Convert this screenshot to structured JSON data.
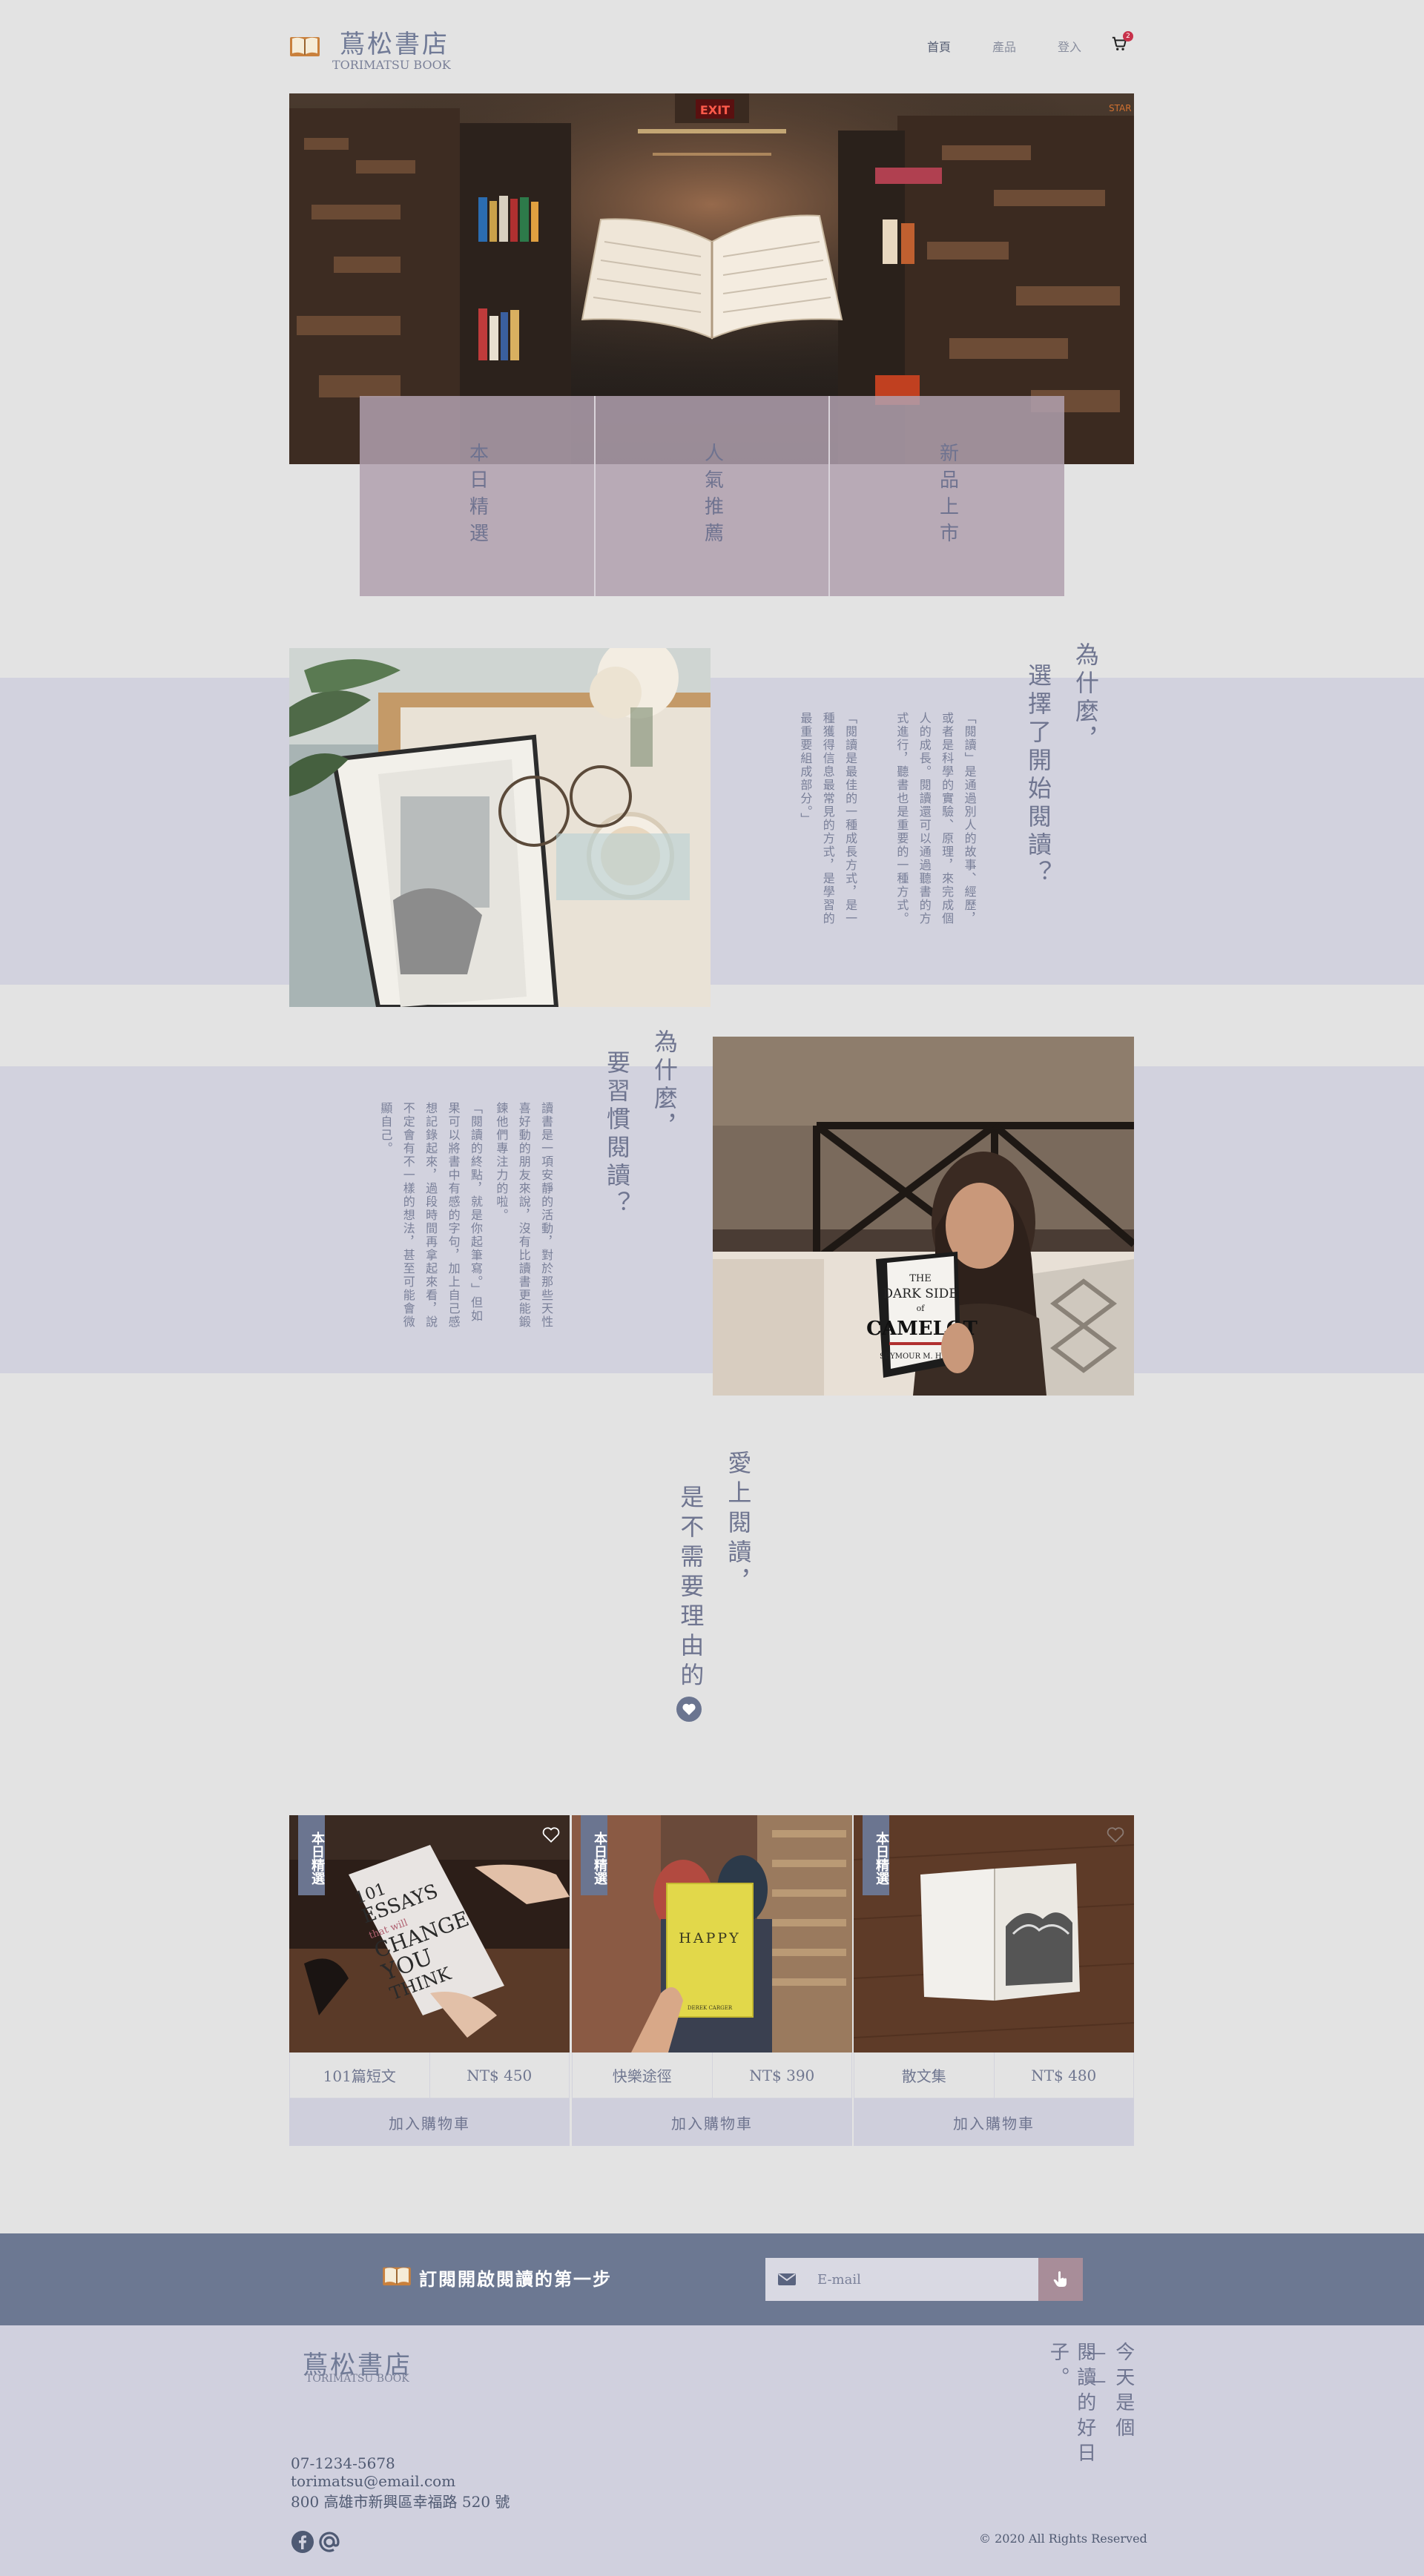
{
  "brand": {
    "name": "蔦松書店",
    "subtitle": "TORIMATSU BOOK"
  },
  "nav": {
    "home": "首頁",
    "products": "產品",
    "login": "登入",
    "cart_count": "2"
  },
  "categories": [
    {
      "label": "本日精選"
    },
    {
      "label": "人氣推薦"
    },
    {
      "label": "新品上市"
    }
  ],
  "section1": {
    "heading_line1": "為什麼，",
    "heading_line2": "選擇了開始閱讀？",
    "para1": "「閱讀」是通過別人的故事、經歷，或者是科學的實驗、原理，來完成個人的成長。閱讀還可以通過聽書的方式進行，聽書也是重要的一種方式。",
    "para2": "「閱讀是最佳的一種成長方式，是一種獲得信息最常見的方式，是學習的最重要組成部分。」"
  },
  "section2": {
    "heading_line1": "為什麼，",
    "heading_line2": "要習慣閱讀？",
    "para1": "讀書是一項安靜的活動，對於那些天性喜好動的朋友來說，沒有比讀書更能鍛鍊他們專注力的啦。",
    "para2": "「閱讀的終點，就是你起筆寫。」但如果可以將書中有感的字句，加上自己感想記錄起來，過段時間再拿起來看，說不定會有不一樣的想法，甚至可能會微顯自己。"
  },
  "love": {
    "line1": "愛上閱讀，",
    "line2": "是不需要理由的"
  },
  "products": [
    {
      "ribbon": "本日精選",
      "name": "101篇短文",
      "price": "NT$ 450",
      "button": "加入購物車"
    },
    {
      "ribbon": "本日精選",
      "name": "快樂途徑",
      "price": "NT$ 390",
      "button": "加入購物車"
    },
    {
      "ribbon": "本日精選",
      "name": "散文集",
      "price": "NT$ 480",
      "button": "加入購物車"
    }
  ],
  "subscribe": {
    "title": "訂閱開啟閱讀的第一步",
    "placeholder": "E-mail"
  },
  "footer": {
    "name": "蔦松書店",
    "subtitle": "TORIMATSU BOOK",
    "phone": "07-1234-5678",
    "email": "torimatsu@email.com",
    "address": "800 高雄市新興區幸福路 520 號",
    "slogan_line1": "今天是個——",
    "slogan_line2": "閱讀的好日子。",
    "copyright": "© 2020 All Rights Reserved"
  },
  "colors": {
    "accent": "#6b7590",
    "band": "#d2d2de",
    "category_overlay": "#b0a0ae",
    "badge": "#c8324b"
  },
  "icons": [
    "book-logo-icon",
    "cart-icon",
    "heart-icon",
    "heart-outline-icon",
    "mail-icon",
    "pointer-icon",
    "facebook-icon",
    "at-icon"
  ]
}
